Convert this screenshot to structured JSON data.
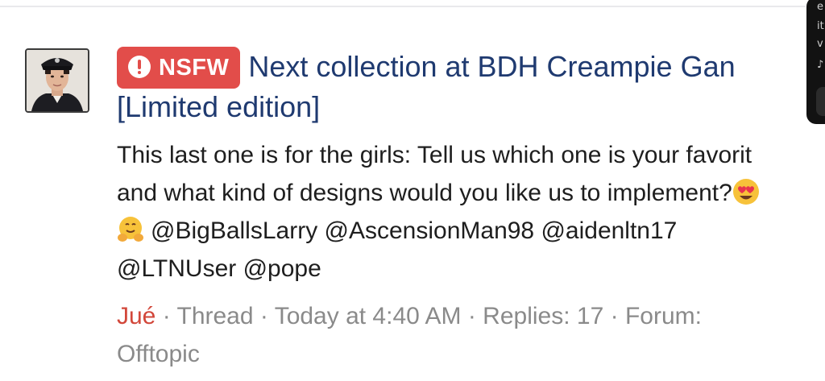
{
  "thread": {
    "badge_label": "NSFW",
    "title_line1": "Next collection at BDH Creampie Gan",
    "title_line2": "[Limited edition]",
    "snippet": {
      "line1": "This last one is for the girls: Tell us which one is your favorit",
      "line2": "and what kind of designs would you like us to implement?",
      "line3_mentions": "@BigBallsLarry @AscensionMan98 @aidenltn17",
      "line4_mentions": "@LTNUser @pope"
    },
    "meta": {
      "author": "Jué",
      "separator": " · ",
      "type": "Thread",
      "time": "Today at 4:40 AM",
      "replies": "Replies: 17",
      "forum": "Forum: Offtopic"
    },
    "icons": {
      "badge": "exclamation-circle-icon",
      "emoji_heart_eyes": "heart-eyes-emoji-icon",
      "emoji_hug": "hugging-face-emoji-icon"
    },
    "colors": {
      "badge_bg": "#e24d4a",
      "title": "#1f3a70",
      "author": "#d2473a",
      "meta": "#8a8a8a"
    }
  },
  "overlay": {
    "line1": "e",
    "line2": "it",
    "line3": "v",
    "line4": "♪"
  }
}
